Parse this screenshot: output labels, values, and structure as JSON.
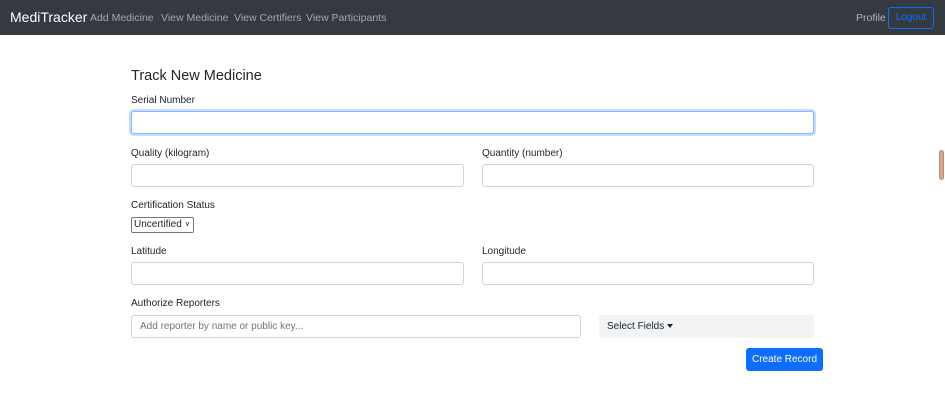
{
  "navbar": {
    "brand": "MediTracker",
    "links": [
      "Add Medicine",
      "View Medicine",
      "View Certifiers",
      "View Participants"
    ],
    "profile": "Profile",
    "logout": "Logout"
  },
  "form": {
    "title": "Track New Medicine",
    "serial_label": "Serial Number",
    "serial_value": "",
    "quality_label": "Quality (kilogram)",
    "quantity_label": "Quantity (number)",
    "cert_label": "Certification Status",
    "cert_selected": "Uncertified",
    "latitude_label": "Latitude",
    "longitude_label": "Longitude",
    "reporters_label": "Authorize Reporters",
    "reporters_placeholder": "Add reporter by name or public key...",
    "select_fields": "Select Fields",
    "create_button": "Create Record"
  }
}
